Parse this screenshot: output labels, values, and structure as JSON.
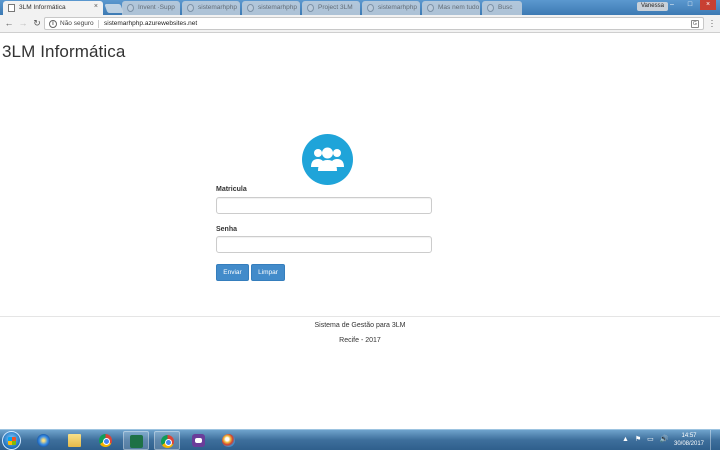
{
  "browser": {
    "active_tab_title": "3LM Informática",
    "tab_close_glyph": "×",
    "inactive_tabs": [
      "Invent ·Supp",
      "sistemarhphp",
      "sistemarhphp",
      "Project 3LM",
      "sistemarhphp",
      "Mas nem tudo",
      "Busc"
    ],
    "user_badge": "Vanessa",
    "window_controls": {
      "minimize": "–",
      "maximize": "□",
      "close": "×"
    },
    "nav": {
      "back_glyph": "←",
      "forward_glyph": "→",
      "reload_glyph": "↻"
    },
    "security_label": "Não seguro",
    "url": "sistemarhphp.azurewebsites.net",
    "icons": {
      "info": "info-icon",
      "translate": "translate-icon",
      "menu": "kebab-menu-icon"
    }
  },
  "page": {
    "title": "3LM Informática",
    "avatar_icon": "users-group-icon",
    "avatar_color": "#1fa4d9",
    "form": {
      "matricula_label": "Matricula",
      "matricula_value": "",
      "senha_label": "Senha",
      "senha_value": "",
      "submit_label": "Enviar",
      "clear_label": "Limpar",
      "button_color": "#428bca"
    },
    "footer": {
      "line1": "Sistema de Gestão para 3LM",
      "line2": "Recife - 2017"
    }
  },
  "taskbar": {
    "pinned": [
      "internet-explorer-icon",
      "file-explorer-icon",
      "chrome-icon",
      "excel-icon",
      "chrome-icon",
      "purple-app-icon",
      "paint-icon"
    ],
    "tray_glyphs": [
      "▲",
      "⚑",
      "▭",
      "🔊"
    ],
    "clock_time": "14:57",
    "clock_date": "30/08/2017"
  }
}
